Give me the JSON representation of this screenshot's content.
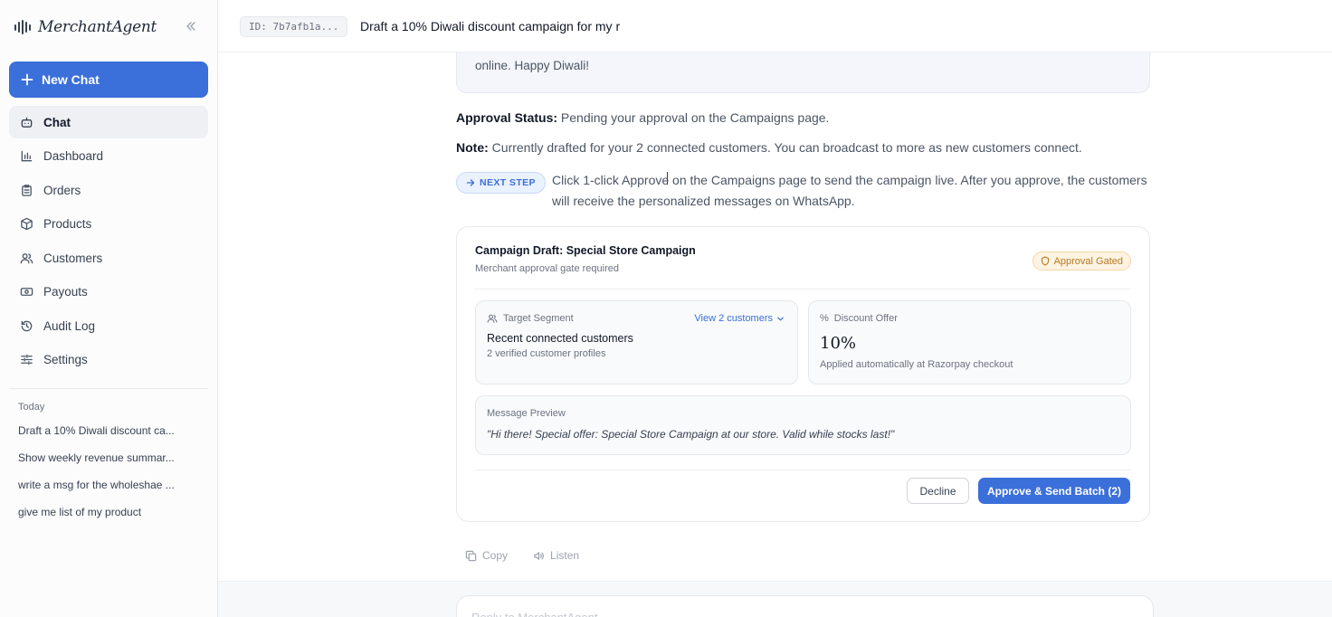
{
  "brand": {
    "name": "MerchantAgent"
  },
  "sidebar": {
    "new_chat_label": "New Chat",
    "nav": [
      {
        "label": "Chat",
        "icon": "bot-icon",
        "active": true
      },
      {
        "label": "Dashboard",
        "icon": "bar-chart-icon"
      },
      {
        "label": "Orders",
        "icon": "clipboard-icon"
      },
      {
        "label": "Products",
        "icon": "box-icon"
      },
      {
        "label": "Customers",
        "icon": "users-icon"
      },
      {
        "label": "Payouts",
        "icon": "banknote-icon"
      },
      {
        "label": "Audit Log",
        "icon": "history-icon"
      },
      {
        "label": "Settings",
        "icon": "sliders-icon"
      }
    ],
    "history_title": "Today",
    "history": [
      "Draft a 10% Diwali discount ca...",
      "Show weekly revenue summar...",
      "write a msg for the wholeshae ...",
      "give me list of my product"
    ]
  },
  "header": {
    "chat_id": "ID: 7b7afb1a...",
    "title": "Draft a 10% Diwali discount campaign for my r"
  },
  "message": {
    "prev_tail": "online. Happy Diwali!",
    "approval_label": "Approval Status:",
    "approval_text": " Pending your approval on the Campaigns page.",
    "note_label": "Note:",
    "note_text": " Currently drafted for your 2 connected customers. You can broadcast to more as new customers connect.",
    "next_step_badge": "NEXT STEP",
    "next_step_text": "Click 1-click Approve on the Campaigns page to send the campaign live. After you approve, the customers will receive the personalized messages on WhatsApp."
  },
  "card": {
    "title": "Campaign Draft: Special Store Campaign",
    "subtitle": "Merchant approval gate required",
    "badge": "Approval Gated",
    "segment": {
      "label": "Target Segment",
      "view_link": "View 2 customers",
      "name": "Recent connected customers",
      "sub": "2 verified customer profiles"
    },
    "discount": {
      "label": "Discount Offer",
      "value": "10%",
      "sub": "Applied automatically at Razorpay checkout"
    },
    "preview": {
      "label": "Message Preview",
      "text": "\"Hi there! Special offer: Special Store Campaign at our store. Valid while stocks last!\""
    },
    "decline_label": "Decline",
    "approve_label": "Approve & Send Batch (2)"
  },
  "actions": {
    "copy": "Copy",
    "listen": "Listen"
  },
  "composer": {
    "placeholder": "Reply to MerchantAgent..."
  },
  "colors": {
    "accent": "#3b6fd9",
    "badge_amber": "#b7791f"
  }
}
